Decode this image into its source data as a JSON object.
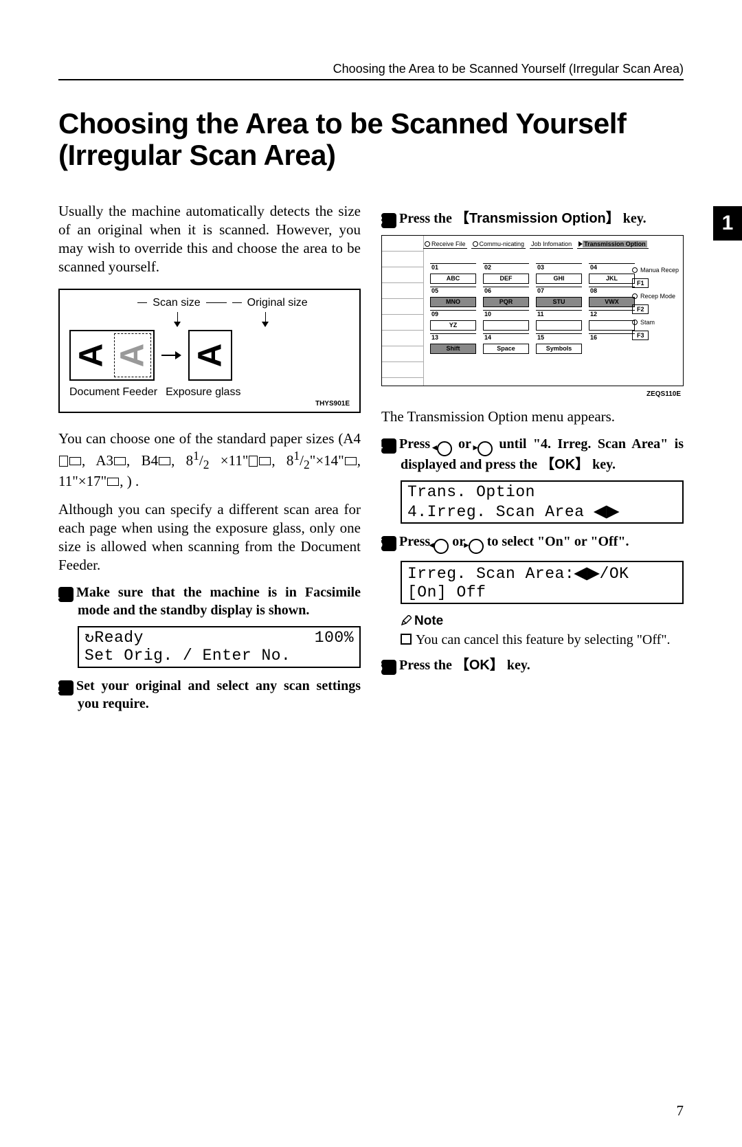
{
  "header": {
    "running": "Choosing the Area to be Scanned Yourself (Irregular Scan Area)",
    "title": "Choosing the Area to be Scanned Yourself (Irregular Scan Area)"
  },
  "intro": {
    "p1": "Usually the machine automatically detects the size of an original when it is scanned. However, you may wish to override this and choose the area to be scanned yourself.",
    "p2a": "You can choose one of the standard paper sizes (A4",
    "p2b": ", A3",
    "p2c": ", B4",
    "p2d": ", 8",
    "p2e": "×11\"",
    "p2f": ", 8",
    "p2g": "\"×14\"",
    "p2h": ", 11\"×17\"",
    "p2i": ", ) .",
    "p3": "Although you can specify a different scan area for each page when using the exposure glass, only one size is allowed when scanning from the Document Feeder.",
    "half_sup": "1",
    "half_sub": "2"
  },
  "diagram": {
    "scan_size": "Scan size",
    "original_size": "Original size",
    "doc_feeder": "Document Feeder",
    "exposure_glass": "Exposure glass",
    "code": "THYS901E"
  },
  "panel": {
    "opts": {
      "receive_file": "Receive File",
      "communicating": "Commu-nicating",
      "job_info": "Job Infomation",
      "trans_option": "Transmission Option"
    },
    "side": {
      "manual_recep": "Manua Recep",
      "f1": "F1",
      "recep_mode": "Recep Mode",
      "f2": "F2",
      "stamp": "Stam",
      "f3": "F3"
    },
    "keys": {
      "r1": [
        "01",
        "02",
        "03",
        "04"
      ],
      "r1b": [
        "ABC",
        "DEF",
        "GHI",
        "JKL"
      ],
      "r2": [
        "05",
        "06",
        "07",
        "08"
      ],
      "r2b": [
        "MNO",
        "PQR",
        "STU",
        "VWX"
      ],
      "r3": [
        "09",
        "10",
        "11",
        "12"
      ],
      "r3b": [
        "YZ",
        "",
        "",
        ""
      ],
      "r4": [
        "13",
        "14",
        "15",
        "16"
      ],
      "r5b": [
        "Shift",
        "Space",
        "Symbols"
      ]
    },
    "code": "ZEQS110E"
  },
  "steps": {
    "s1": "Make sure that the machine is in Facsimile mode and the standby display is shown.",
    "lcd1a": "Ready",
    "lcd1b": "100%",
    "lcd1c": "Set Orig. / Enter No.",
    "s2": "Set your original and select any scan settings you require.",
    "s3a": "Press the ",
    "s3key": "Transmission Option",
    "s3b": " key.",
    "after_panel": "The Transmission Option menu appears.",
    "s4a": "Press ",
    "s4b": " or ",
    "s4c": " until \"4. Irreg. Scan Area\" is displayed and press the ",
    "s4key": "OK",
    "s4d": " key.",
    "lcd4a": "Trans. Option",
    "lcd4b": " 4.Irreg. Scan Area ",
    "s5a": "Press ",
    "s5b": " or ",
    "s5c": " to select \"On\" or \"Off\".",
    "lcd5a": "Irreg. Scan Area:",
    "lcd5b": "/OK",
    "lcd5c": " [On]   Off",
    "note_head": "Note",
    "note_body": "You can cancel this feature by selecting \"Off\".",
    "s6a": "Press the ",
    "s6key": "OK",
    "s6b": " key."
  },
  "tab": "1",
  "page_number": "7"
}
